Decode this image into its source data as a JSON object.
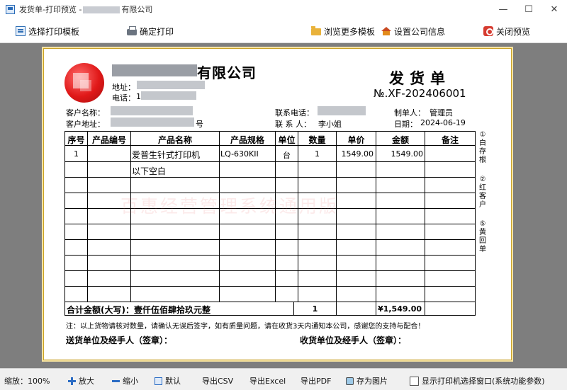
{
  "window": {
    "title_prefix": "发货单-打印预览 -",
    "title_suffix": "有限公司",
    "buttons": {
      "minimize": "—",
      "maximize": "☐",
      "close": "✕"
    }
  },
  "toolbar": {
    "select_template": "选择打印模板",
    "confirm_print": "确定打印",
    "browse_templates": "浏览更多模板",
    "company_settings": "设置公司信息",
    "close_preview": "关闭预览"
  },
  "document": {
    "company_name_suffix": "有限公司",
    "address_label": "地址：",
    "phone_label": "电话：",
    "phone_partial": "1",
    "title": "发货单",
    "number": "№.XF-202406001",
    "customer_name_label": "客户名称：",
    "customer_address_label": "客户地址：",
    "customer_address_suffix": "号",
    "contact_phone_label": "联系电话：",
    "contact_person_label": "联 系 人：",
    "contact_person": "李小姐",
    "maker_label": "制单人：",
    "maker": "管理员",
    "date_label": "日期：",
    "date": "2024-06-19",
    "columns": [
      "序号",
      "产品编号",
      "产品名称",
      "产品规格",
      "单位",
      "数量",
      "单价",
      "金额",
      "备注"
    ],
    "row1": {
      "seq": "1",
      "code": "",
      "name": "爱普生针式打印机",
      "spec": "LQ-630KII",
      "unit": "台",
      "qty": "1",
      "price": "1549.00",
      "amount": "1549.00",
      "remark": ""
    },
    "row2_text": "以下空白",
    "total_label": "合计金额(大写)：壹仟伍佰肆拾玖元整",
    "total_qty": "1",
    "total_amount": "¥1,549.00",
    "side_labels": [
      "①",
      "白",
      "存",
      "根",
      "",
      "②",
      "红",
      "客",
      "户",
      "",
      "⑤",
      "黄",
      "回",
      "单"
    ],
    "watermark": "百惠经营管理系统通用版",
    "note": "注：以上货物请核对数量，请确认无误后签字，如有质量问题，请在收货3天内通知本公司，感谢您的支持与配合！",
    "delivery_sign": "送货单位及经手人（签章）：",
    "receive_sign": "收货单位及经手人（签章）："
  },
  "statusbar": {
    "zoom_label": "缩放：",
    "zoom_value": "100%",
    "zoom_in": "放大",
    "zoom_out": "缩小",
    "default": "默认",
    "export_csv": "导出CSV",
    "export_excel": "导出Excel",
    "export_pdf": "导出PDF",
    "save_image": "存为图片",
    "show_printer_dialog": "显示打印机选择窗口(系统功能参数)"
  }
}
